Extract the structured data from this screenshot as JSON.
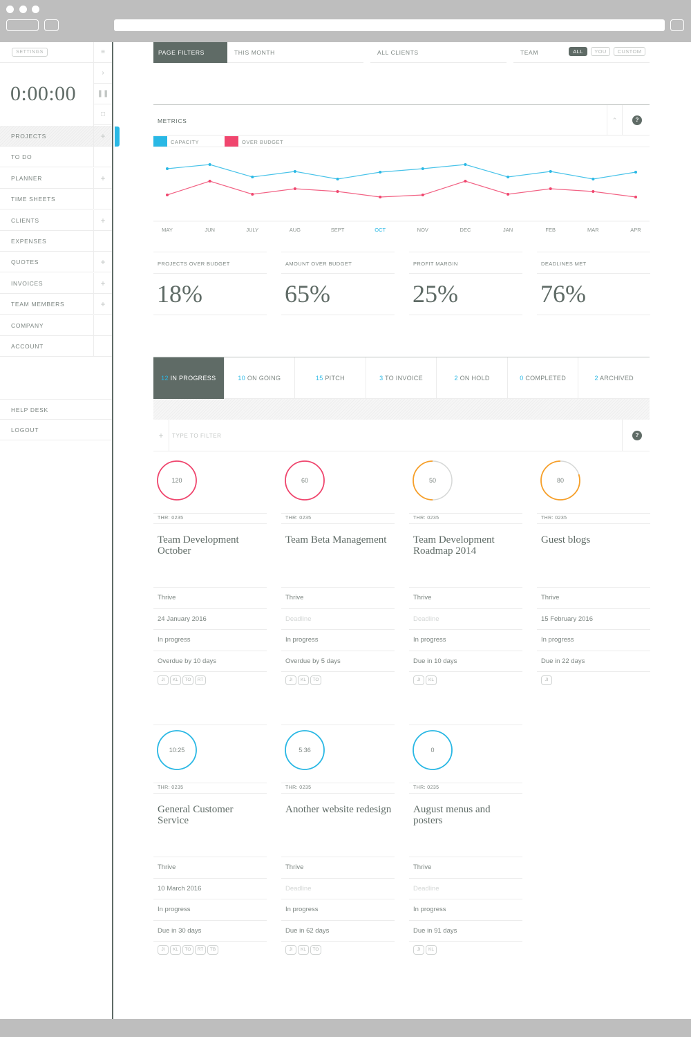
{
  "sidebar": {
    "settings_label": "SETTINGS",
    "timer": "0:00:00",
    "timer_controls": [
      "play-icon",
      "pause-icon",
      "stop-icon"
    ],
    "items": [
      {
        "label": "PROJECTS",
        "has_add": true,
        "active": true
      },
      {
        "label": "TO DO",
        "has_add": false
      },
      {
        "label": "PLANNER",
        "has_add": true
      },
      {
        "label": "TIME SHEETS",
        "has_add": false
      },
      {
        "label": "CLIENTS",
        "has_add": true
      },
      {
        "label": "EXPENSES",
        "has_add": false
      },
      {
        "label": "QUOTES",
        "has_add": true
      },
      {
        "label": "INVOICES",
        "has_add": true
      },
      {
        "label": "TEAM MEMBERS",
        "has_add": true
      },
      {
        "label": "COMPANY",
        "has_add": false
      },
      {
        "label": "ACCOUNT",
        "has_add": false
      }
    ],
    "footer_items": [
      {
        "label": "HELP DESK"
      },
      {
        "label": "LOGOUT"
      }
    ]
  },
  "filters": {
    "page_filters": "PAGE FILTERS",
    "period": "THIS MONTH",
    "clients": "ALL CLIENTS",
    "team_label": "TEAM",
    "team_options": [
      {
        "label": "ALL",
        "selected": true
      },
      {
        "label": "YOU",
        "selected": false
      },
      {
        "label": "CUSTOM",
        "selected": false
      }
    ]
  },
  "metrics": {
    "title": "METRICS",
    "help": "?",
    "collapse_icon": "chevron-up-icon"
  },
  "colors": {
    "capacity": "#29b8e5",
    "over_budget": "#f0466e",
    "accent_dark": "#5f6b66",
    "progress_orange": "#f7a02a"
  },
  "chart_data": {
    "type": "line",
    "title": "METRICS",
    "xlabel": "",
    "ylabel": "",
    "x": [
      "MAY",
      "JUN",
      "JULY",
      "AUG",
      "SEPT",
      "OCT",
      "NOV",
      "DEC",
      "JAN",
      "FEB",
      "MAR",
      "APR"
    ],
    "highlight_x": "OCT",
    "ylim": [
      0,
      100
    ],
    "grid": false,
    "legend": "top-left",
    "series": [
      {
        "name": "CAPACITY",
        "color": "#29b8e5",
        "values": [
          70,
          76,
          58,
          66,
          55,
          65,
          70,
          76,
          58,
          66,
          55,
          65
        ]
      },
      {
        "name": "OVER BUDGET",
        "color": "#f0466e",
        "values": [
          32,
          52,
          33,
          41,
          37,
          29,
          32,
          52,
          33,
          41,
          37,
          29
        ]
      }
    ]
  },
  "stats": [
    {
      "label": "PROJECTS OVER BUDGET",
      "value": "18%"
    },
    {
      "label": "AMOUNT OVER BUDGET",
      "value": "65%"
    },
    {
      "label": "PROFIT MARGIN",
      "value": "25%"
    },
    {
      "label": "DEADLINES MET",
      "value": "76%"
    }
  ],
  "tabs": [
    {
      "count": "12",
      "label": " IN PROGRESS",
      "active": true
    },
    {
      "count": "10",
      "label": " ON GOING"
    },
    {
      "count": "15",
      "label": " PITCH"
    },
    {
      "count": "3",
      "label": " TO INVOICE"
    },
    {
      "count": "2",
      "label": " ON HOLD"
    },
    {
      "count": "0",
      "label": " COMPLETED"
    },
    {
      "count": "2",
      "label": " ARCHIVED"
    }
  ],
  "filter_input": {
    "placeholder": "TYPE TO FILTER",
    "value": ""
  },
  "projects": [
    {
      "ring": "120",
      "ring_color": "#f0466e",
      "progress": 1.0,
      "code": "THR: 0235",
      "name": "Team Development October",
      "client": "Thrive",
      "deadline": "24 January 2016",
      "deadline_placeholder": false,
      "status": "In progress",
      "due": "Overdue by 10 days",
      "members": [
        "JI",
        "KL",
        "TO",
        "RT"
      ]
    },
    {
      "ring": "60",
      "ring_color": "#f0466e",
      "progress": 1.0,
      "code": "THR: 0235",
      "name": "Team Beta Management",
      "client": "Thrive",
      "deadline": "Deadline",
      "deadline_placeholder": true,
      "status": "In progress",
      "due": "Overdue by 5 days",
      "members": [
        "JI",
        "KL",
        "TO"
      ]
    },
    {
      "ring": "50",
      "ring_color": "#f7a02a",
      "progress": 0.5,
      "code": "THR: 0235",
      "name": "Team Development Roadmap 2014",
      "client": "Thrive",
      "deadline": "Deadline",
      "deadline_placeholder": true,
      "status": "In progress",
      "due": "Due in 10 days",
      "members": [
        "JI",
        "KL"
      ]
    },
    {
      "ring": "80",
      "ring_color": "#f7a02a",
      "progress": 0.8,
      "code": "THR: 0235",
      "name": "Guest blogs",
      "client": "Thrive",
      "deadline": "15 February 2016",
      "deadline_placeholder": false,
      "status": "In progress",
      "due": "Due in 22 days",
      "members": [
        "JI"
      ]
    },
    {
      "ring": "10:25",
      "ring_color": "#29b8e5",
      "progress": 1.0,
      "code": "THR: 0235",
      "name": "General Customer Service",
      "client": "Thrive",
      "deadline": "10 March 2016",
      "deadline_placeholder": false,
      "status": "In progress",
      "due": "Due in 30 days",
      "members": [
        "JI",
        "KL",
        "TO",
        "RT",
        "TB"
      ]
    },
    {
      "ring": "5:36",
      "ring_color": "#29b8e5",
      "progress": 1.0,
      "code": "THR: 0235",
      "name": "Another website redesign",
      "client": "Thrive",
      "deadline": "Deadline",
      "deadline_placeholder": true,
      "status": "In progress",
      "due": "Due in 62 days",
      "members": [
        "JI",
        "KL",
        "TO"
      ]
    },
    {
      "ring": "0",
      "ring_color": "#29b8e5",
      "progress": 1.0,
      "code": "THR: 0235",
      "name": "August menus and posters",
      "client": "Thrive",
      "deadline": "Deadline",
      "deadline_placeholder": true,
      "status": "In progress",
      "due": "Due in 91 days",
      "members": [
        "JI",
        "KL"
      ]
    }
  ]
}
